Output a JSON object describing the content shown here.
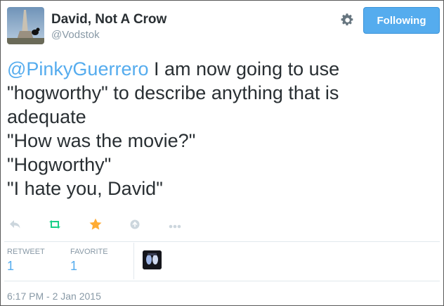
{
  "user": {
    "display_name": "David, Not A Crow",
    "username": "@Vodstok"
  },
  "follow_button": {
    "label": "Following"
  },
  "tweet": {
    "mention": "@PinkyGuerrero",
    "line1_rest": " I am now going to use",
    "line2": "\"hogworthy\" to describe anything that is",
    "line3": "adequate",
    "line4": "\"How was the movie?\"",
    "line5": "\"Hogworthy\"",
    "line6": "\"I hate you, David\""
  },
  "actions": {
    "reply_icon": "reply-icon",
    "retweet_icon": "retweet-icon",
    "favorite_icon": "star-icon",
    "share_icon": "share-icon",
    "more_icon": "more-icon"
  },
  "stats": {
    "retweet_label": "RETWEET",
    "retweet_count": "1",
    "favorite_label": "FAVORITE",
    "favorite_count": "1"
  },
  "timestamp": "6:17 PM - 2 Jan 2015",
  "colors": {
    "accent": "#55acee",
    "retweet_green": "#19cf86",
    "star_gold": "#ffac33",
    "muted": "#8899a6"
  }
}
